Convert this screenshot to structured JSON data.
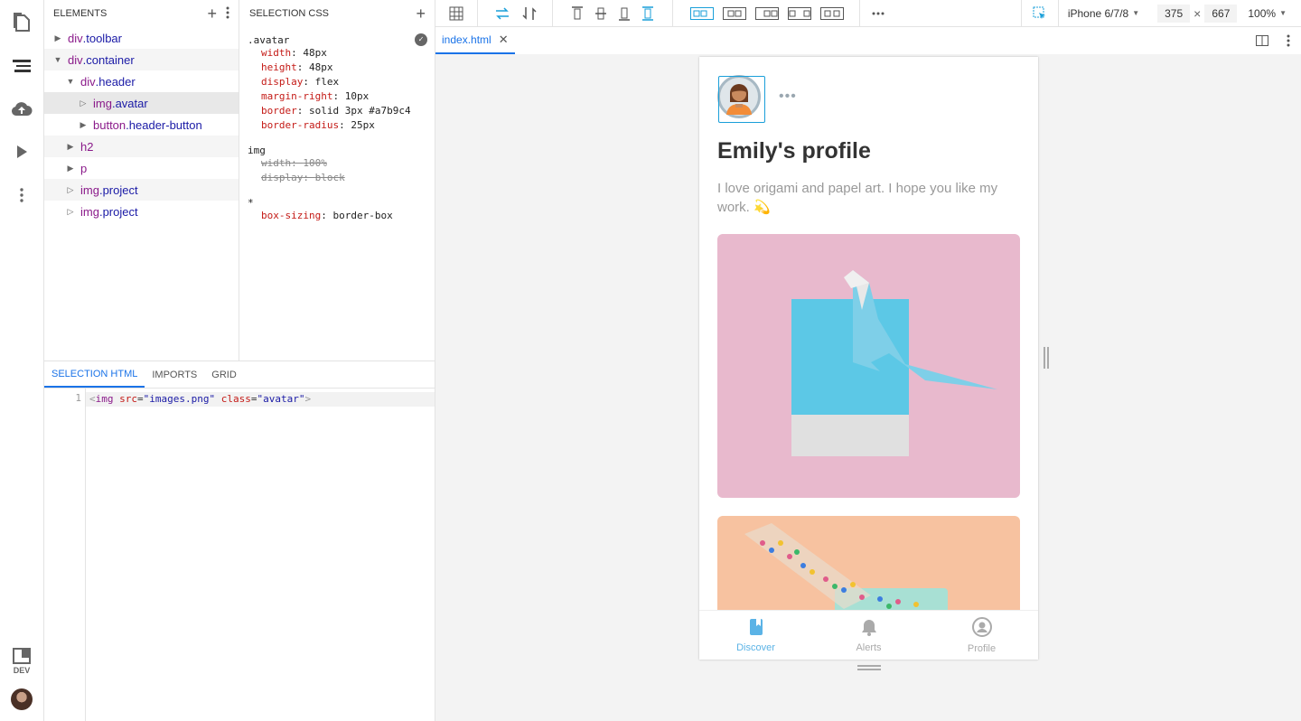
{
  "rail": {
    "icons": [
      "files-icon",
      "layers-icon",
      "cloud-upload-icon",
      "play-icon",
      "more-vertical-icon",
      "panel-layout-icon"
    ],
    "dev_label": "DEV"
  },
  "elements_panel": {
    "title": "ELEMENTS",
    "tree": [
      {
        "depth": 0,
        "caret": "▶",
        "tag": "div",
        "cls": ".toolbar"
      },
      {
        "depth": 0,
        "caret": "▼",
        "tag": "div",
        "cls": ".container"
      },
      {
        "depth": 1,
        "caret": "▼",
        "tag": "div",
        "cls": ".header"
      },
      {
        "depth": 2,
        "caret": "▷",
        "tag": "img",
        "cls": ".avatar",
        "selected": true
      },
      {
        "depth": 2,
        "caret": "▶",
        "tag": "button",
        "cls": ".header-button"
      },
      {
        "depth": 1,
        "caret": "▶",
        "tag": "h2",
        "cls": ""
      },
      {
        "depth": 1,
        "caret": "▶",
        "tag": "p",
        "cls": ""
      },
      {
        "depth": 1,
        "caret": "▷",
        "tag": "img",
        "cls": ".project"
      },
      {
        "depth": 1,
        "caret": "▷",
        "tag": "img",
        "cls": ".project"
      }
    ]
  },
  "css_panel": {
    "title": "SELECTION CSS",
    "rules": [
      {
        "selector": ".avatar",
        "checked": true,
        "decls": [
          {
            "prop": "width",
            "value": "48px"
          },
          {
            "prop": "height",
            "value": "48px"
          },
          {
            "prop": "display",
            "value": "flex"
          },
          {
            "prop": "margin-right",
            "value": "10px"
          },
          {
            "prop": "border",
            "value": "solid 3px #a7b9c4"
          },
          {
            "prop": "border-radius",
            "value": "25px"
          }
        ]
      },
      {
        "selector": "img",
        "checked": false,
        "decls": [
          {
            "prop": "width",
            "value": "100%",
            "struck": true
          },
          {
            "prop": "display",
            "value": "block",
            "struck": true
          }
        ]
      },
      {
        "selector": "*",
        "checked": false,
        "decls": [
          {
            "prop": "box-sizing",
            "value": "border-box"
          }
        ]
      }
    ]
  },
  "html_panel": {
    "tabs": [
      "SELECTION HTML",
      "IMPORTS",
      "GRID"
    ],
    "active_tab": 0,
    "line_number": "1",
    "code": {
      "open": "<",
      "tag": "img",
      "attr1": "src",
      "val1": "\"images.png\"",
      "attr2": "class",
      "val2": "\"avatar\"",
      "close": ">"
    }
  },
  "toolbar": {
    "device": "iPhone 6/7/8",
    "width": "375",
    "times": "×",
    "height": "667",
    "zoom": "100%"
  },
  "file_tab": {
    "name": "index.html"
  },
  "preview": {
    "title": "Emily's profile",
    "bio": "I love origami and papel art. I hope you like my work. 💫",
    "dots": "•••",
    "nav": [
      {
        "label": "Discover",
        "icon": "bookmark-icon",
        "active": true
      },
      {
        "label": "Alerts",
        "icon": "bell-icon",
        "active": false
      },
      {
        "label": "Profile",
        "icon": "user-icon",
        "active": false
      }
    ]
  },
  "colors": {
    "accent": "#1a73e8",
    "avatar_border": "#a7b9c4",
    "nav_active": "#5bb3e6"
  }
}
